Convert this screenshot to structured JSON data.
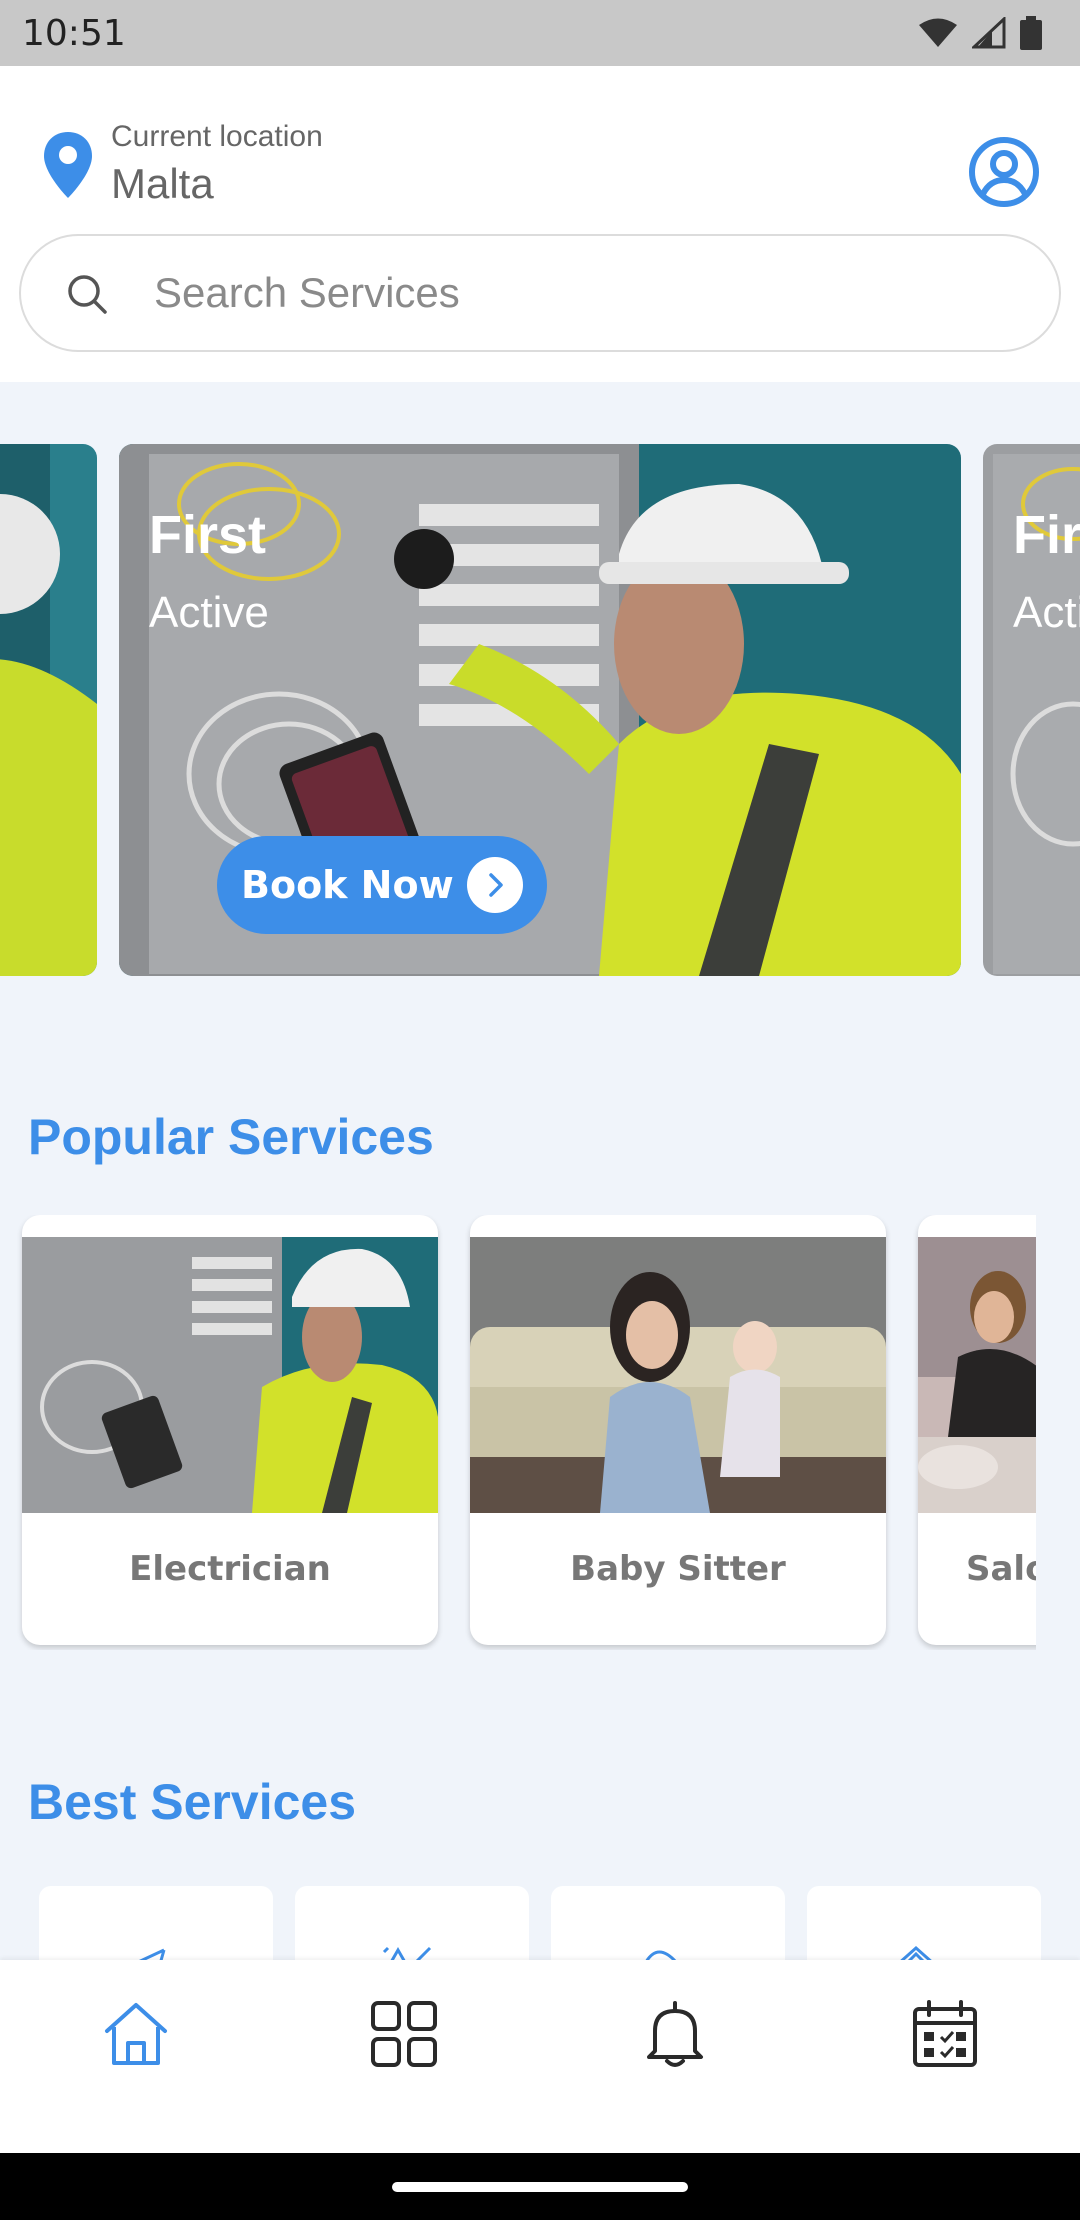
{
  "status_bar": {
    "time": "10:51"
  },
  "location": {
    "caption": "Current location",
    "value": "Malta"
  },
  "search": {
    "placeholder": "Search Services"
  },
  "banner": {
    "title": "First",
    "subtitle": "Active",
    "button_label": "Book Now"
  },
  "popular": {
    "title": "Popular Services",
    "items": [
      {
        "label": "Electrician"
      },
      {
        "label": "Baby Sitter"
      },
      {
        "label": "Salon"
      }
    ]
  },
  "best": {
    "title": "Best Services"
  },
  "colors": {
    "accent": "#3d8ee8",
    "background": "#f0f4fa",
    "card": "#ffffff"
  },
  "icons": {
    "nav": [
      "home-icon",
      "grid-icon",
      "bell-icon",
      "calendar-icon"
    ]
  }
}
